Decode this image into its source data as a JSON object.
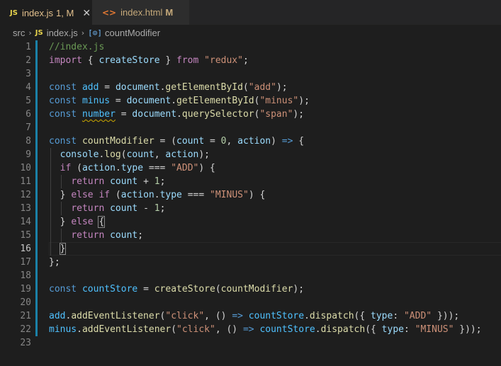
{
  "tabs": [
    {
      "icon": "JS",
      "name": "index.js",
      "badge": "1, M",
      "close": "✕"
    },
    {
      "icon": "<>",
      "name": "index.html",
      "badge": "M"
    }
  ],
  "breadcrumb": {
    "folder": "src",
    "file_icon": "JS",
    "file": "index.js",
    "symbol_icon": "[⊙]",
    "symbol": "countModifier"
  },
  "editor": {
    "current_line": 16,
    "lines": [
      {
        "n": "1"
      },
      {
        "n": "2"
      },
      {
        "n": "3"
      },
      {
        "n": "4"
      },
      {
        "n": "5"
      },
      {
        "n": "6"
      },
      {
        "n": "7"
      },
      {
        "n": "8"
      },
      {
        "n": "9"
      },
      {
        "n": "10"
      },
      {
        "n": "11"
      },
      {
        "n": "12"
      },
      {
        "n": "13"
      },
      {
        "n": "14"
      },
      {
        "n": "15"
      },
      {
        "n": "16"
      },
      {
        "n": "17"
      },
      {
        "n": "18"
      },
      {
        "n": "19"
      },
      {
        "n": "20"
      },
      {
        "n": "21"
      },
      {
        "n": "22"
      },
      {
        "n": "23"
      }
    ],
    "code": {
      "l1": "//index.js",
      "l2_import": "import",
      "l2_open": " { ",
      "l2_name": "createStore",
      "l2_close": " } ",
      "l2_from": "from",
      "l2_str": "\"redux\"",
      "l2_end": ";",
      "const": "const",
      "add": "add",
      "minus": "minus",
      "number": "number",
      "document": "document",
      "getById": "getElementById",
      "querySel": "querySelector",
      "str_add": "\"add\"",
      "str_minus": "\"minus\"",
      "str_span": "\"span\"",
      "countModifier": "countModifier",
      "count": "count",
      "zero": "0",
      "action": "action",
      "console": "console",
      "log": "log",
      "if": "if",
      "type": "type",
      "str_ADD": "\"ADD\"",
      "return": "return",
      "one": "1",
      "else": "else",
      "str_MINUS": "\"MINUS\"",
      "countStore": "countStore",
      "createStore": "createStore",
      "addEventListener": "addEventListener",
      "str_click": "\"click\"",
      "dispatch": "dispatch",
      "type_key": "type"
    }
  }
}
